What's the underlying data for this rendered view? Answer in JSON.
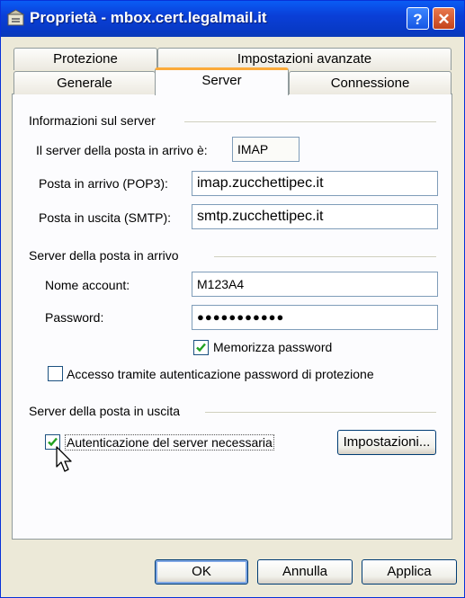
{
  "window": {
    "title": "Proprietà - mbox.cert.legalmail.it",
    "help": "?",
    "close": "✕"
  },
  "tabs": {
    "row1": [
      {
        "label": "Protezione"
      },
      {
        "label": "Impostazioni avanzate"
      }
    ],
    "row2": [
      {
        "label": "Generale"
      },
      {
        "label": "Server",
        "active": true
      },
      {
        "label": "Connessione"
      }
    ]
  },
  "server_info": {
    "title": "Informazioni sul server",
    "incoming_type_label": "Il server della posta in arrivo è:",
    "incoming_type_value": "IMAP",
    "incoming_label": "Posta in arrivo (POP3):",
    "incoming_value": "imap.zucchettipec.it",
    "outgoing_label": "Posta in uscita (SMTP):",
    "outgoing_value": "smtp.zucchettipec.it"
  },
  "incoming_server": {
    "title": "Server della posta in arrivo",
    "account_label": "Nome account:",
    "account_value": "M123A4",
    "password_label": "Password:",
    "password_value": "●●●●●●●●●●●",
    "remember_label": "Memorizza password",
    "remember_checked": true,
    "spa_label": "Accesso tramite autenticazione password di protezione",
    "spa_checked": false
  },
  "outgoing_server": {
    "title": "Server della posta in uscita",
    "auth_label": "Autenticazione del server necessaria",
    "auth_checked": true,
    "settings_button": "Impostazioni..."
  },
  "buttons": {
    "ok": "OK",
    "cancel": "Annulla",
    "apply": "Applica"
  }
}
